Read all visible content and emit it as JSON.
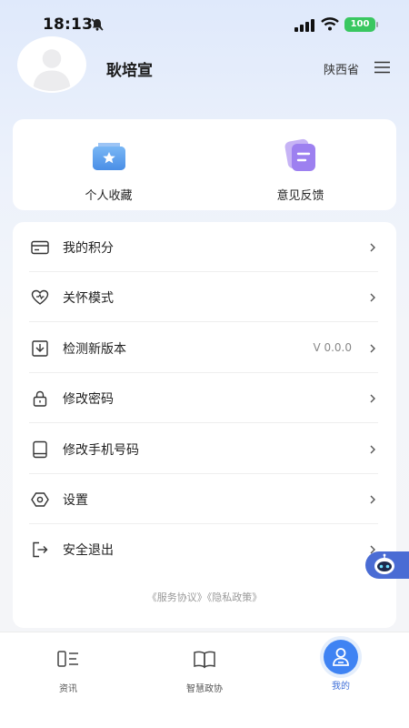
{
  "status_bar": {
    "time": "18:13",
    "battery": "100"
  },
  "profile": {
    "name": "耿培宣",
    "region": "陕西省"
  },
  "quick_actions": [
    {
      "label": "个人收藏",
      "icon": "favorites-icon"
    },
    {
      "label": "意见反馈",
      "icon": "feedback-icon"
    }
  ],
  "menu": [
    {
      "label": "我的积分",
      "icon": "card-icon",
      "value": ""
    },
    {
      "label": "关怀模式",
      "icon": "heart-icon",
      "value": ""
    },
    {
      "label": "检测新版本",
      "icon": "update-icon",
      "value": "V 0.0.0"
    },
    {
      "label": "修改密码",
      "icon": "lock-icon",
      "value": ""
    },
    {
      "label": "修改手机号码",
      "icon": "phone-icon",
      "value": ""
    },
    {
      "label": "设置",
      "icon": "settings-icon",
      "value": ""
    },
    {
      "label": "安全退出",
      "icon": "logout-icon",
      "value": ""
    }
  ],
  "agreements": "《服务协议》《隐私政策》",
  "bottom_nav": [
    {
      "label": "资讯",
      "icon": "news-icon",
      "active": false
    },
    {
      "label": "智慧政协",
      "icon": "book-icon",
      "active": false
    },
    {
      "label": "我的",
      "icon": "user-icon",
      "active": true
    }
  ],
  "colors": {
    "accent": "#3f83f3",
    "battery": "#39c760",
    "robot": "#4a6cd4"
  }
}
